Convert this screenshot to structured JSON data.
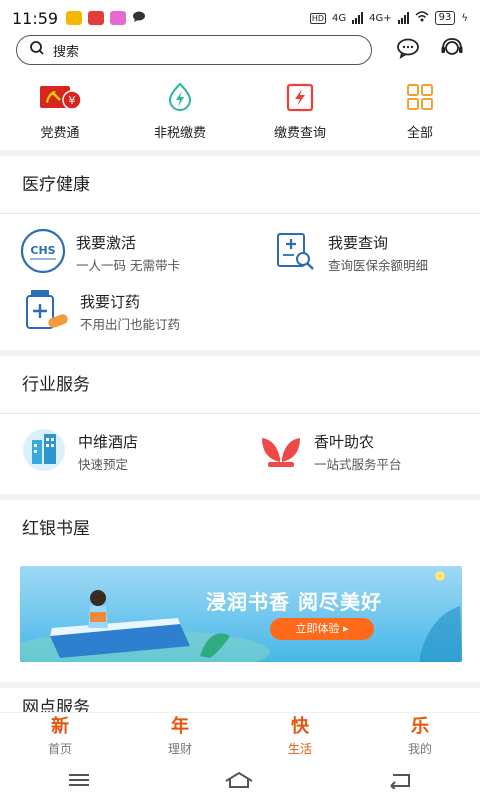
{
  "status_bar": {
    "time": "11:59",
    "network": "4G",
    "network2": "4G+",
    "battery": "93"
  },
  "search": {
    "placeholder": "搜索"
  },
  "quick_menu": [
    {
      "label": "党费通",
      "icon": "party-emblem-icon",
      "color": "#d7261e"
    },
    {
      "label": "非税缴费",
      "icon": "lightning-drop-icon",
      "color": "#2ab5a0"
    },
    {
      "label": "缴费查询",
      "icon": "bill-lightning-icon",
      "color": "#e8403a"
    },
    {
      "label": "全部",
      "icon": "grid-icon",
      "color": "#f0a22e"
    }
  ],
  "medical": {
    "title": "医疗健康",
    "items": [
      {
        "title": "我要激活",
        "sub": "一人一码 无需带卡",
        "icon": "chs-badge-icon"
      },
      {
        "title": "我要查询",
        "sub": "查询医保余额明细",
        "icon": "medical-search-icon"
      },
      {
        "title": "我要订药",
        "sub": "不用出门也能订药",
        "icon": "medicine-bottle-icon"
      }
    ]
  },
  "industry": {
    "title": "行业服务",
    "items": [
      {
        "title": "中维酒店",
        "sub": "快速预定",
        "icon": "hotel-building-icon"
      },
      {
        "title": "香叶助农",
        "sub": "一站式服务平台",
        "icon": "leaf-sprout-icon"
      }
    ]
  },
  "books": {
    "title": "红银书屋",
    "banner_slogan": "浸润书香  阅尽美好",
    "banner_button": "立即体验 ▸"
  },
  "outlet": {
    "title": "网点服务"
  },
  "tabs": [
    {
      "glyph": "新",
      "label": "首页"
    },
    {
      "glyph": "年",
      "label": "理财"
    },
    {
      "glyph": "快",
      "label": "生活"
    },
    {
      "glyph": "乐",
      "label": "我的"
    }
  ],
  "colors": {
    "accent": "#e8540c",
    "brand_red": "#d7261e",
    "banner_blue": "#47b7e8"
  }
}
